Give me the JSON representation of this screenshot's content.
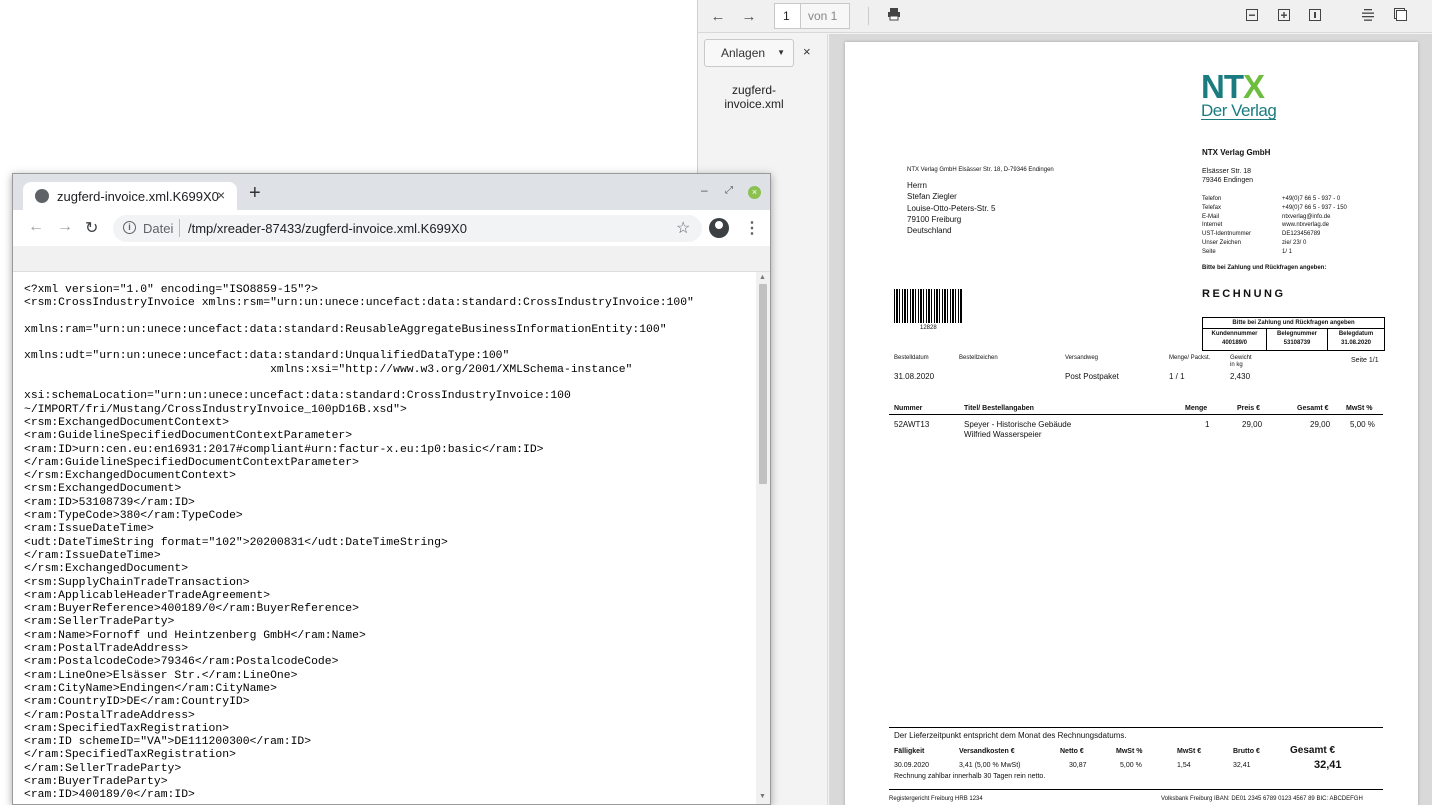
{
  "pdf_viewer": {
    "toolbar": {
      "page_number": "1",
      "page_total": "von 1"
    },
    "sidebar": {
      "dropdown_label": "Anlagen",
      "close_label": "×",
      "attachment_line1": "zugferd-",
      "attachment_line2": "invoice.xml"
    },
    "invoice": {
      "logo_top": "NTX",
      "logo_bottom": "Der Verlag",
      "sender_line": "NTX Verlag GmbH Elsässer Str. 18, D-79346 Endingen",
      "recipient": [
        "Herrn",
        "Stefan Ziegler",
        "Louise-Otto-Peters-Str. 5",
        "79100 Freiburg",
        "Deutschland"
      ],
      "company_name": "NTX Verlag GmbH",
      "company_street": "Elsässer Str. 18",
      "company_city": "79346 Endingen",
      "contact_labels": [
        "Telefon",
        "Telefax",
        "E-Mail",
        "Internet",
        "UST-Identnummer",
        "Unser Zeichen",
        "Seite"
      ],
      "contact_values": [
        "+49(0)7 66 5 - 937 - 0",
        "+49(0)7 66 5 - 937 - 150",
        "ntxverlag@info.de",
        "www.ntxverlag.de",
        "DE123456789",
        "zie/ 23/ 0",
        "1/ 1"
      ],
      "payment_note": "Bitte bei Zahlung und Rückfragen angeben:",
      "title": "RECHNUNG",
      "barcode_number": "12828",
      "ref_box": {
        "header": "Bitte bei Zahlung und Rückfragen angeben",
        "labels": [
          "Kundennummer",
          "Belegnummer",
          "Belegdatum"
        ],
        "values": [
          "400189/0",
          "53108739",
          "31.08.2020"
        ]
      },
      "order_headers": [
        "Bestelldatum",
        "Bestellzeichen",
        "Versandweg",
        "Menge/ Packst.",
        "Gewicht",
        "in kg"
      ],
      "order_values": {
        "date": "31.08.2020",
        "shipping": "Post Postpaket",
        "qty": "1 / 1",
        "weight": "2,430",
        "page": "Seite 1/1"
      },
      "table_headers": [
        "Nummer",
        "Titel/ Bestellangaben",
        "Menge",
        "Preis €",
        "Gesamt €",
        "MwSt %"
      ],
      "line_item": {
        "number": "52AWT13",
        "title1": "Speyer - Historische Gebäude",
        "title2": "Wilfried Wasserspeier",
        "qty": "1",
        "price": "29,00",
        "total": "29,00",
        "vat": "5,00 %"
      },
      "footer_note": "Der Lieferzeitpunkt entspricht dem Monat des Rechnungsdatums.",
      "totals_headers": [
        "Fälligkeit",
        "Versandkosten €",
        "Netto €",
        "MwSt %",
        "MwSt €",
        "Brutto €",
        "Gesamt €"
      ],
      "totals_values": [
        "30.09.2020",
        "3,41 (5,00 % MwSt)",
        "30,87",
        "5,00 %",
        "1,54",
        "32,41",
        "32,41"
      ],
      "payment_terms": "Rechnung zahlbar innerhalb 30 Tagen rein netto.",
      "registry": "Registergericht Freiburg HRB 1234",
      "bank": "Volksbank Freiburg IBAN: DE01 2345 6789 0123 4567 89 BIC: ABCDEFGH"
    }
  },
  "browser": {
    "tab_title": "zugferd-invoice.xml.K699X0",
    "tab_close": "×",
    "new_tab": "+",
    "url_scheme": "Datei",
    "url": "/tmp/xreader-87433/zugferd-invoice.xml.K699X0",
    "xml_source": "<?xml version=\"1.0\" encoding=\"ISO8859-15\"?>\n<rsm:CrossIndustryInvoice xmlns:rsm=\"urn:un:unece:uncefact:data:standard:CrossIndustryInvoice:100\"\n\nxmlns:ram=\"urn:un:unece:uncefact:data:standard:ReusableAggregateBusinessInformationEntity:100\"\n\nxmlns:udt=\"urn:un:unece:uncefact:data:standard:UnqualifiedDataType:100\"\n                                    xmlns:xsi=\"http://www.w3.org/2001/XMLSchema-instance\"\n\nxsi:schemaLocation=\"urn:un:unece:uncefact:data:standard:CrossIndustryInvoice:100\n~/IMPORT/fri/Mustang/CrossIndustryInvoice_100pD16B.xsd\">\n<rsm:ExchangedDocumentContext>\n<ram:GuidelineSpecifiedDocumentContextParameter>\n<ram:ID>urn:cen.eu:en16931:2017#compliant#urn:factur-x.eu:1p0:basic</ram:ID>\n</ram:GuidelineSpecifiedDocumentContextParameter>\n</rsm:ExchangedDocumentContext>\n<rsm:ExchangedDocument>\n<ram:ID>53108739</ram:ID>\n<ram:TypeCode>380</ram:TypeCode>\n<ram:IssueDateTime>\n<udt:DateTimeString format=\"102\">20200831</udt:DateTimeString>\n</ram:IssueDateTime>\n</rsm:ExchangedDocument>\n<rsm:SupplyChainTradeTransaction>\n<ram:ApplicableHeaderTradeAgreement>\n<ram:BuyerReference>400189/0</ram:BuyerReference>\n<ram:SellerTradeParty>\n<ram:Name>Fornoff und Heintzenberg GmbH</ram:Name>\n<ram:PostalTradeAddress>\n<ram:PostalcodeCode>79346</ram:PostalcodeCode>\n<ram:LineOne>Elsässer Str.</ram:LineOne>\n<ram:CityName>Endingen</ram:CityName>\n<ram:CountryID>DE</ram:CountryID>\n</ram:PostalTradeAddress>\n<ram:SpecifiedTaxRegistration>\n<ram:ID schemeID=\"VA\">DE111200300</ram:ID>\n</ram:SpecifiedTaxRegistration>\n</ram:SellerTradeParty>\n<ram:BuyerTradeParty>\n<ram:ID>400189/0</ram:ID>"
  }
}
